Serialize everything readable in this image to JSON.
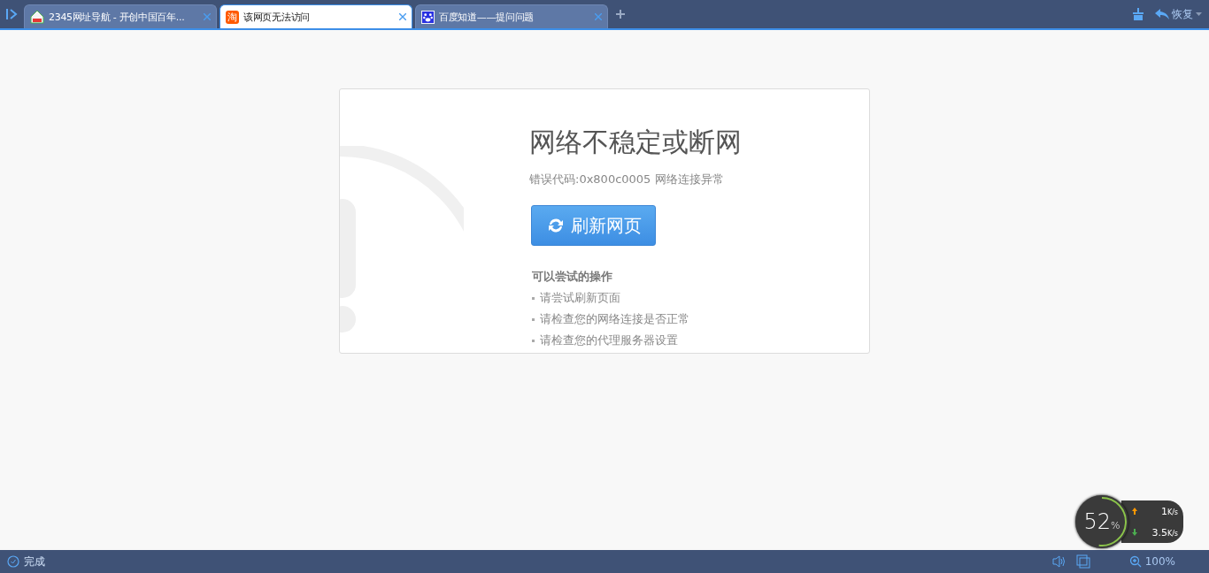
{
  "tabs": [
    {
      "kind": "house",
      "label": "2345网址导航 - 开创中国百年...",
      "selected": false
    },
    {
      "kind": "shop",
      "icon_text": "淘",
      "label": "该网页无法访问",
      "selected": true
    },
    {
      "kind": "paw",
      "label": "百度知道——提问问题",
      "selected": false
    }
  ],
  "toolbar": {
    "restore_label": "恢复"
  },
  "error": {
    "title": "网络不稳定或断网",
    "code": "错误代码:0x800c0005 网络连接异常",
    "refresh_button": "刷新网页",
    "tips_heading": "可以尝试的操作",
    "tips": [
      "请尝试刷新页面",
      "请检查您的网络连接是否正常",
      "请检查您的代理服务器设置"
    ]
  },
  "status_bar": {
    "status": "完成",
    "zoom": "100%"
  },
  "speed_widget": {
    "percent": "52",
    "percent_unit": "%",
    "upload": "1",
    "upload_unit": "K/s",
    "download": "3.5",
    "download_unit": "K/s"
  }
}
